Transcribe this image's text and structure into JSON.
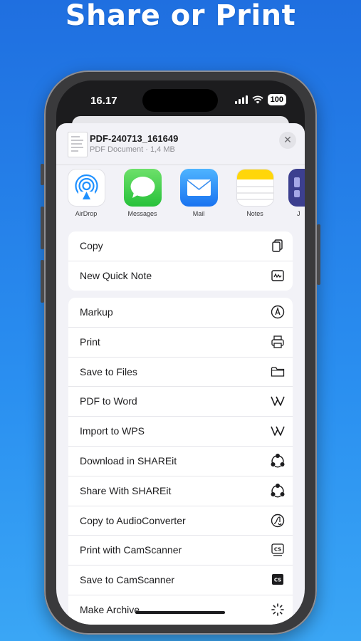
{
  "headline": "Share or Print",
  "status_bar": {
    "time": "16.17",
    "battery": "100"
  },
  "document": {
    "title": "PDF-240713_161649",
    "subtitle": "PDF Document · 1,4 MB"
  },
  "apps": [
    {
      "label": "AirDrop",
      "icon": "airdrop-icon"
    },
    {
      "label": "Messages",
      "icon": "messages-icon"
    },
    {
      "label": "Mail",
      "icon": "mail-icon"
    },
    {
      "label": "Notes",
      "icon": "notes-icon"
    },
    {
      "label": "J",
      "icon": "app-icon"
    }
  ],
  "group1": [
    {
      "label": "Copy",
      "icon": "copy-icon"
    },
    {
      "label": "New Quick Note",
      "icon": "quick-note-icon"
    }
  ],
  "group2": [
    {
      "label": "Markup",
      "icon": "markup-icon"
    },
    {
      "label": "Print",
      "icon": "printer-icon"
    },
    {
      "label": "Save to Files",
      "icon": "folder-icon"
    },
    {
      "label": "PDF to Word",
      "icon": "wps-icon"
    },
    {
      "label": "Import to WPS",
      "icon": "wps-icon"
    },
    {
      "label": "Download in SHAREit",
      "icon": "shareit-icon"
    },
    {
      "label": "Share With SHAREit",
      "icon": "shareit-icon"
    },
    {
      "label": "Copy to AudioConverter",
      "icon": "audio-converter-icon"
    },
    {
      "label": "Print with CamScanner",
      "icon": "camscanner-icon"
    },
    {
      "label": "Save to CamScanner",
      "icon": "camscanner-icon"
    },
    {
      "label": "Make Archive",
      "icon": "archive-icon"
    }
  ],
  "colors": {
    "background": "#2a8ff0",
    "sheet": "#f2f2f7"
  }
}
